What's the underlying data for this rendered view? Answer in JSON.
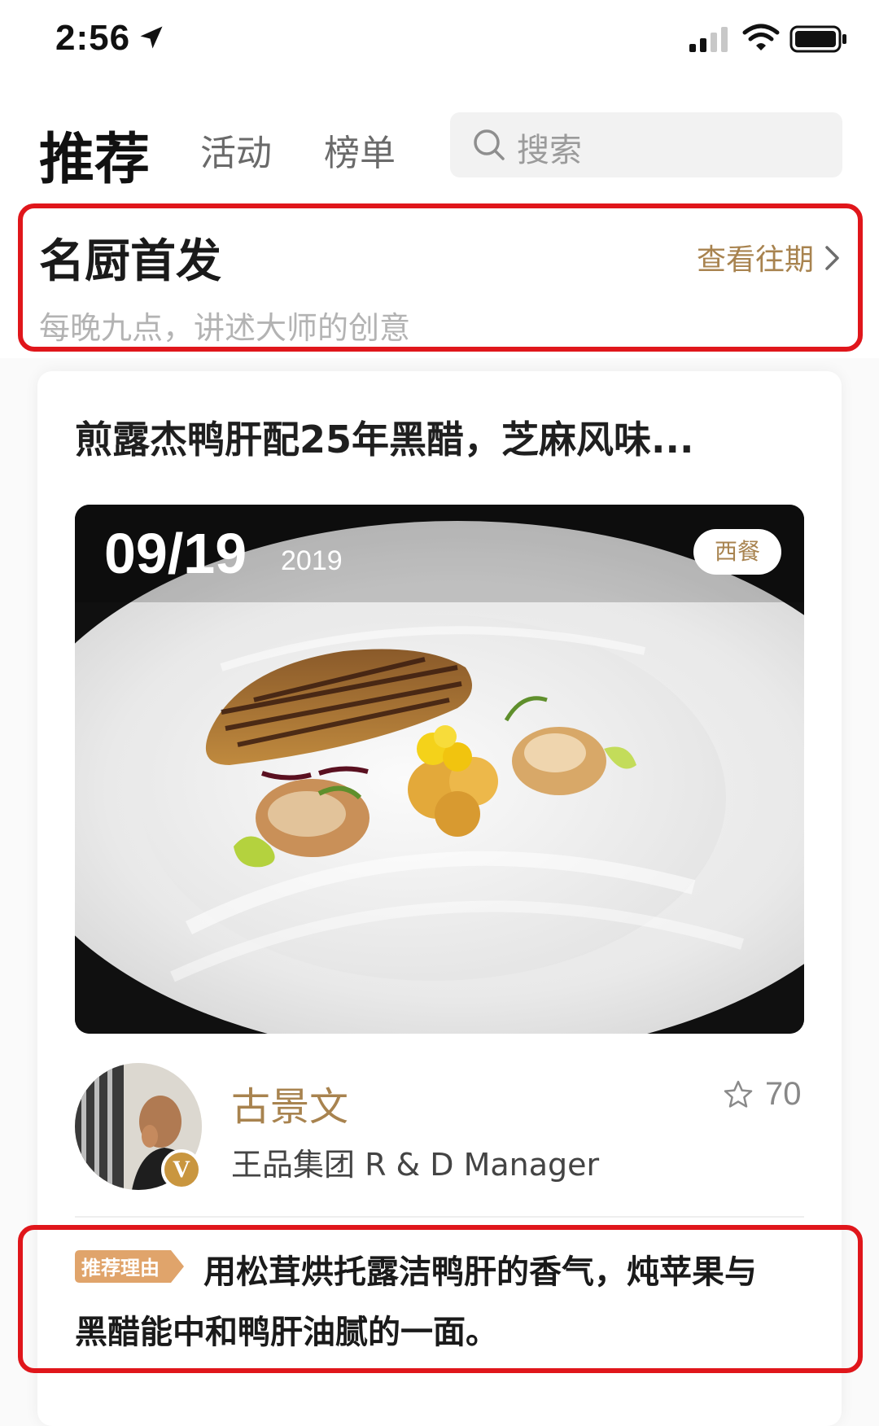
{
  "status_bar": {
    "time": "2:56"
  },
  "nav": {
    "active_tab": "推荐",
    "tabs": [
      "活动",
      "榜单"
    ],
    "search_placeholder": "搜索"
  },
  "section": {
    "title": "名厨首发",
    "subtitle": "每晚九点，讲述大师的创意",
    "history_link": "查看往期"
  },
  "card": {
    "title": "煎露杰鸭肝配25年黑醋，芝麻风味...",
    "date_day": "09/19",
    "date_year": "2019",
    "category": "西餐",
    "chef": {
      "name": "古景文",
      "title": "王品集团 R & D Manager",
      "verified_mark": "V"
    },
    "favorite_count": "70",
    "reason_tag": "推荐理由",
    "reason_line_1": "用松茸烘托露洁鸭肝的香气，炖苹果与",
    "reason_line_2": "黑醋能中和鸭肝油腻的一面。"
  },
  "colors": {
    "accent_gold": "#a8834f",
    "annotation_red": "#e0161b",
    "tag_orange": "#e0a46b"
  },
  "icons": [
    "location-arrow-icon",
    "signal-icon",
    "wifi-icon",
    "battery-icon",
    "search-icon",
    "chevron-right-icon",
    "star-icon"
  ]
}
